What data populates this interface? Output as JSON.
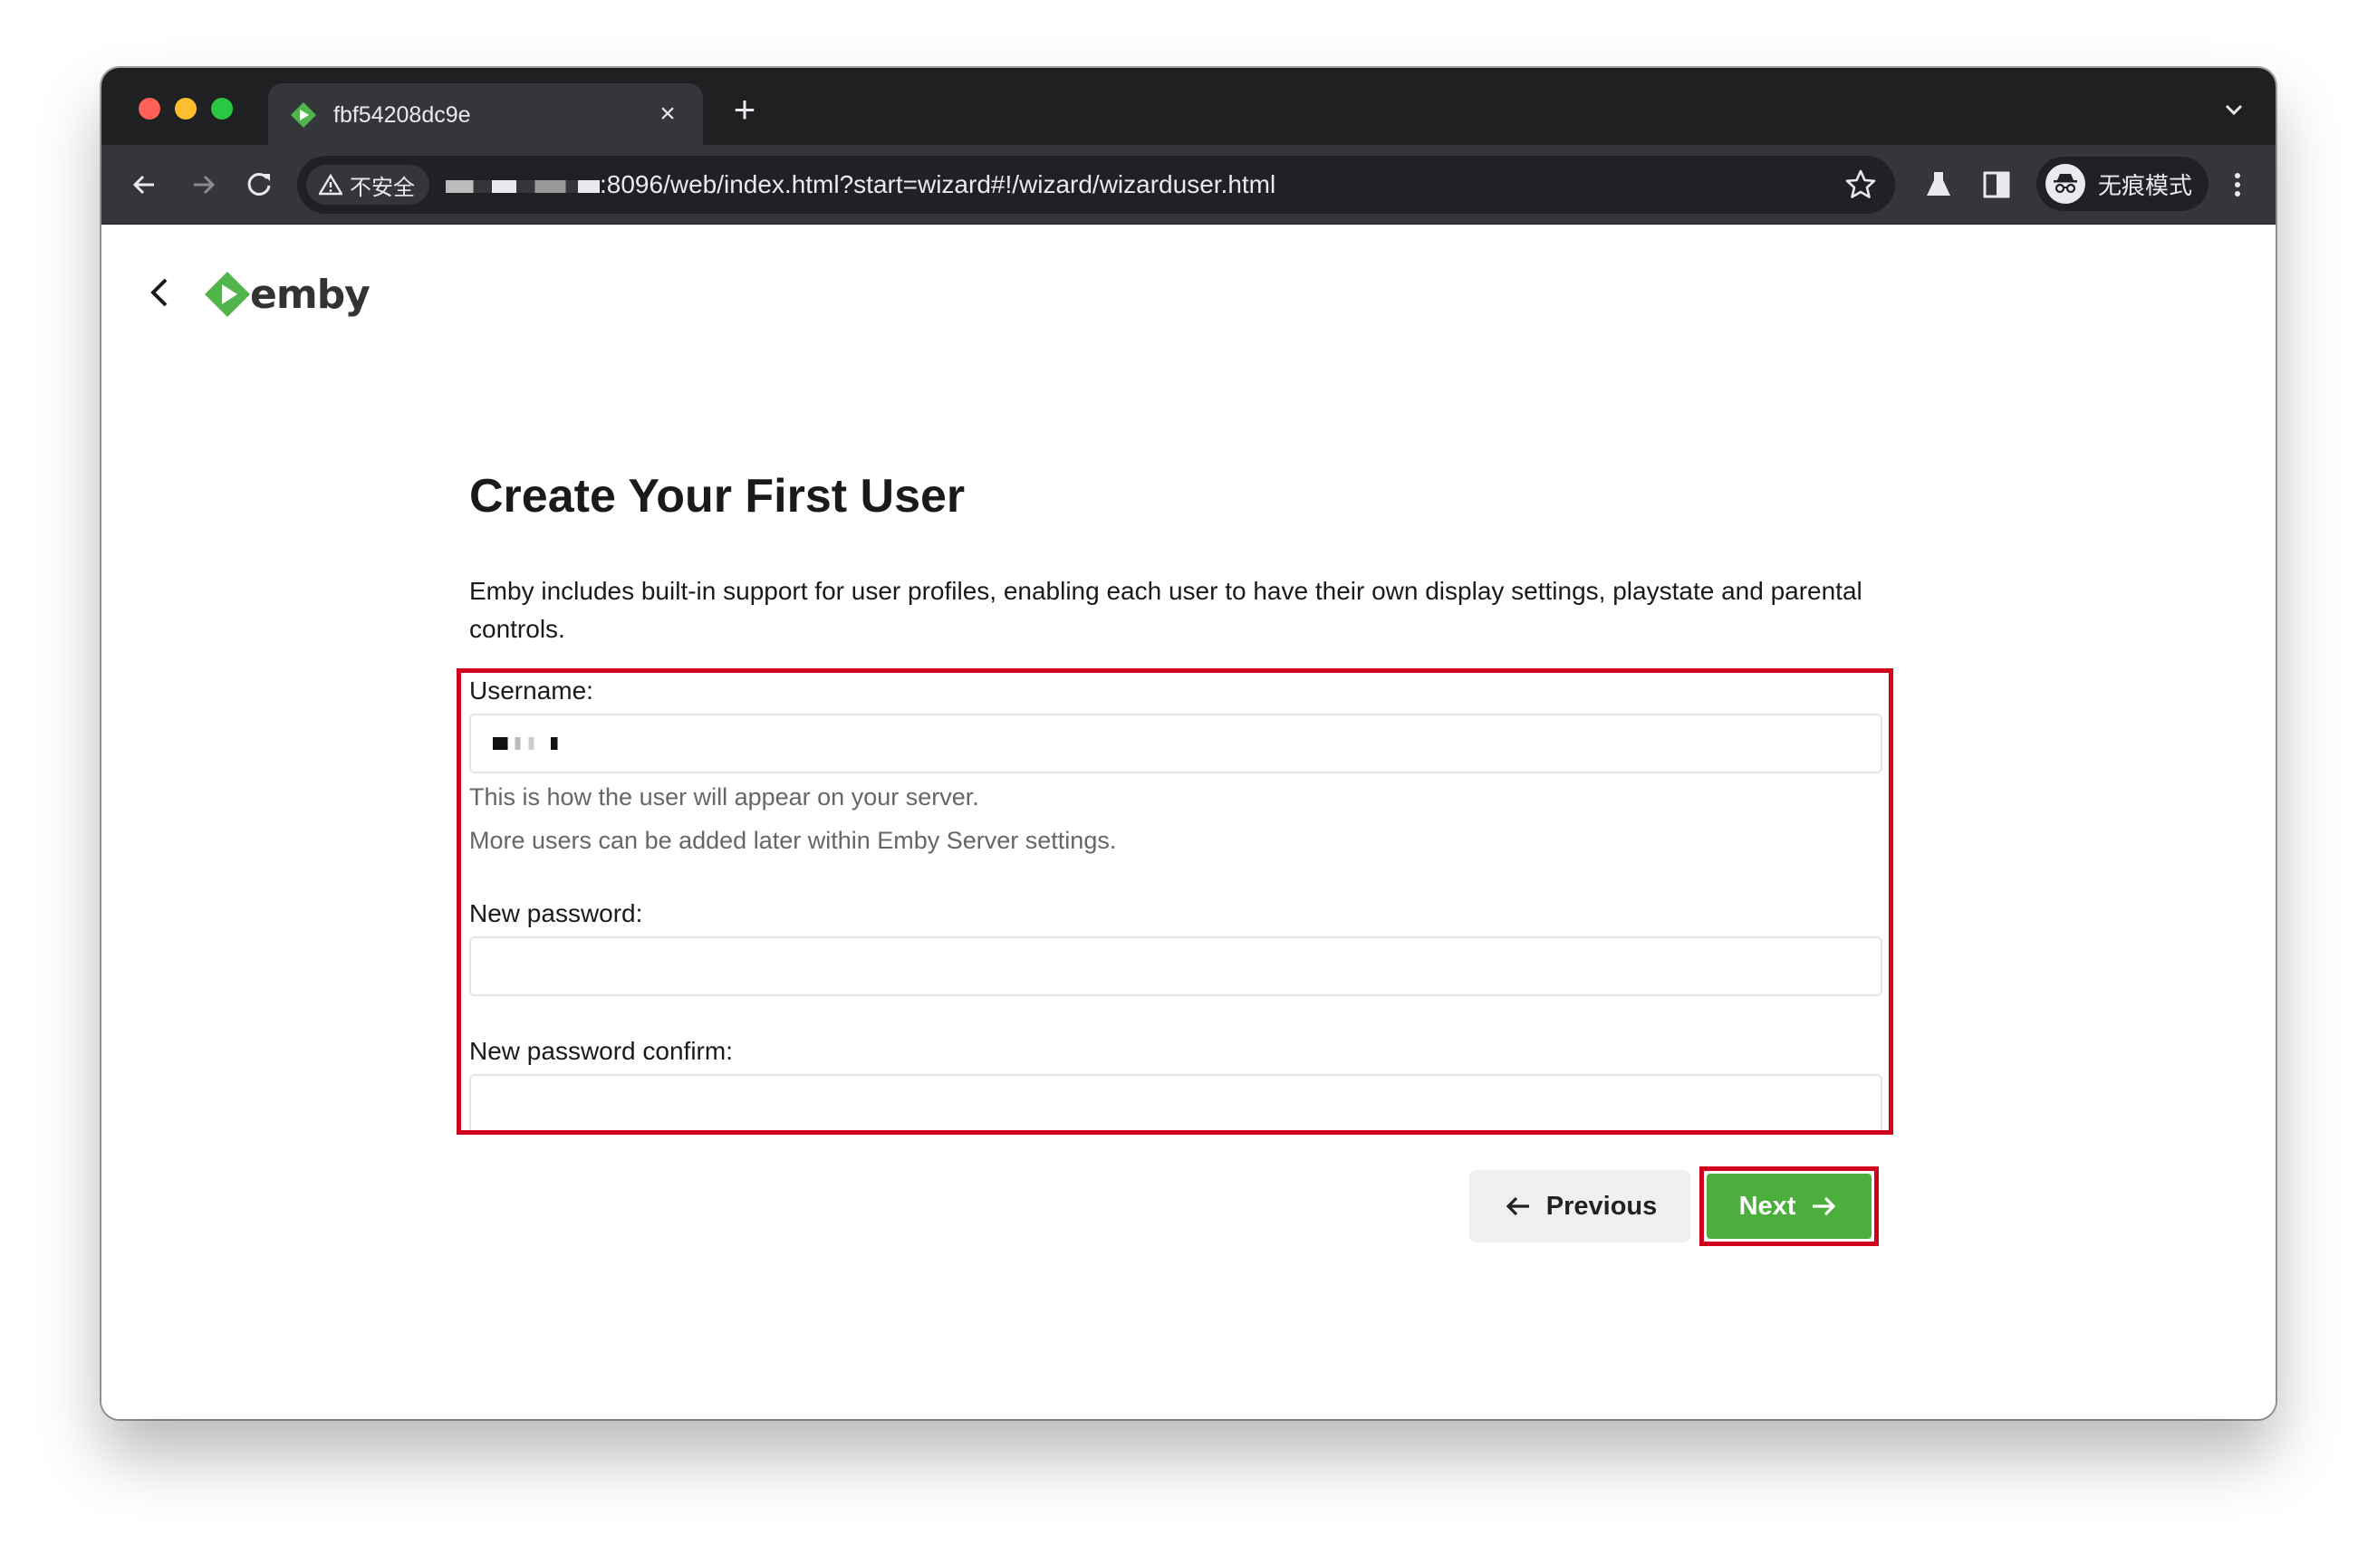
{
  "browser": {
    "tab_title": "fbf54208dc9e",
    "tab_close": "×",
    "new_tab": "+",
    "security_label": "不安全",
    "url_suffix": ":8096/web/index.html?start=wizard#!/wizard/wizarduser.html",
    "incognito_label": "无痕模式"
  },
  "app": {
    "logo_text": "emby"
  },
  "wizard": {
    "title": "Create Your First User",
    "description": "Emby includes built-in support for user profiles, enabling each user to have their own display settings, playstate and parental controls.",
    "username_label": "Username:",
    "username_helper_1": "This is how the user will appear on your server.",
    "username_helper_2": "More users can be added later within Emby Server settings.",
    "password_label": "New password:",
    "password_value": "",
    "password_confirm_label": "New password confirm:",
    "password_confirm_value": "",
    "previous_label": "Previous",
    "next_label": "Next"
  },
  "colors": {
    "accent_green": "#4caf3d",
    "highlight_red": "#d0021b"
  }
}
